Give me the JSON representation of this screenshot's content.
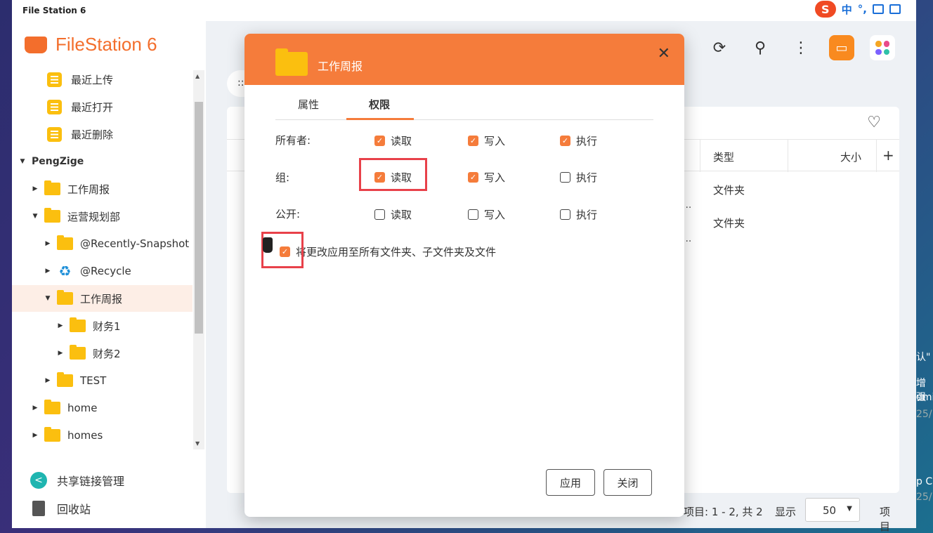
{
  "window": {
    "title": "File Station 6"
  },
  "ime": {
    "lang": "中",
    "punct": "°,"
  },
  "brand": {
    "name": "FileStation 6"
  },
  "sidebar": {
    "items": [
      {
        "label": "最近上传"
      },
      {
        "label": "最近打开"
      },
      {
        "label": "最近删除"
      },
      {
        "label": "PengZige"
      },
      {
        "label": "工作周报"
      },
      {
        "label": "运营规划部"
      },
      {
        "label": "@Recently-Snapshot"
      },
      {
        "label": "@Recycle"
      },
      {
        "label": "工作周报"
      },
      {
        "label": "财务1"
      },
      {
        "label": "财务2"
      },
      {
        "label": "TEST"
      },
      {
        "label": "home"
      },
      {
        "label": "homes"
      }
    ],
    "share_links": "共享链接管理",
    "recycle_bin": "回收站"
  },
  "toolbar": {
    "search_hint": "::"
  },
  "file_list": {
    "columns": {
      "type": "类型",
      "size": "大小",
      "add": "+"
    },
    "rows": [
      {
        "type": "文件夹",
        "dots": "..."
      },
      {
        "type": "文件夹",
        "dots": "..."
      }
    ]
  },
  "footer": {
    "count": "项目: 1 - 2, 共 2",
    "show_label": "显示",
    "per_page": "50",
    "unit": "项目"
  },
  "dialog": {
    "title": "工作周报",
    "tabs": [
      {
        "label": "属性"
      },
      {
        "label": "权限"
      }
    ],
    "active_tab": "权限",
    "rows": [
      {
        "label": "所有者:",
        "read": "读取",
        "write": "写入",
        "exec": "执行",
        "read_on": true,
        "write_on": true,
        "exec_on": true
      },
      {
        "label": "组:",
        "read": "读取",
        "write": "写入",
        "exec": "执行",
        "read_on": true,
        "write_on": true,
        "exec_on": false
      },
      {
        "label": "公开:",
        "read": "读取",
        "write": "写入",
        "exec": "执行",
        "read_on": false,
        "write_on": false,
        "exec_on": false
      }
    ],
    "apply_all": "将更改应用至所有文件夹、子文件夹及文件",
    "apply_button": "应用",
    "close_button": "关闭"
  },
  "desktop_peek": {
    "line1": "认\"",
    "line2": "增强",
    "line3": "dmi",
    "line4": "25/",
    "line5": "p C",
    "line6": "25/"
  },
  "colors": {
    "accent": "#f57c3b",
    "folder": "#fbbf0f",
    "highlight": "#e8414a"
  }
}
